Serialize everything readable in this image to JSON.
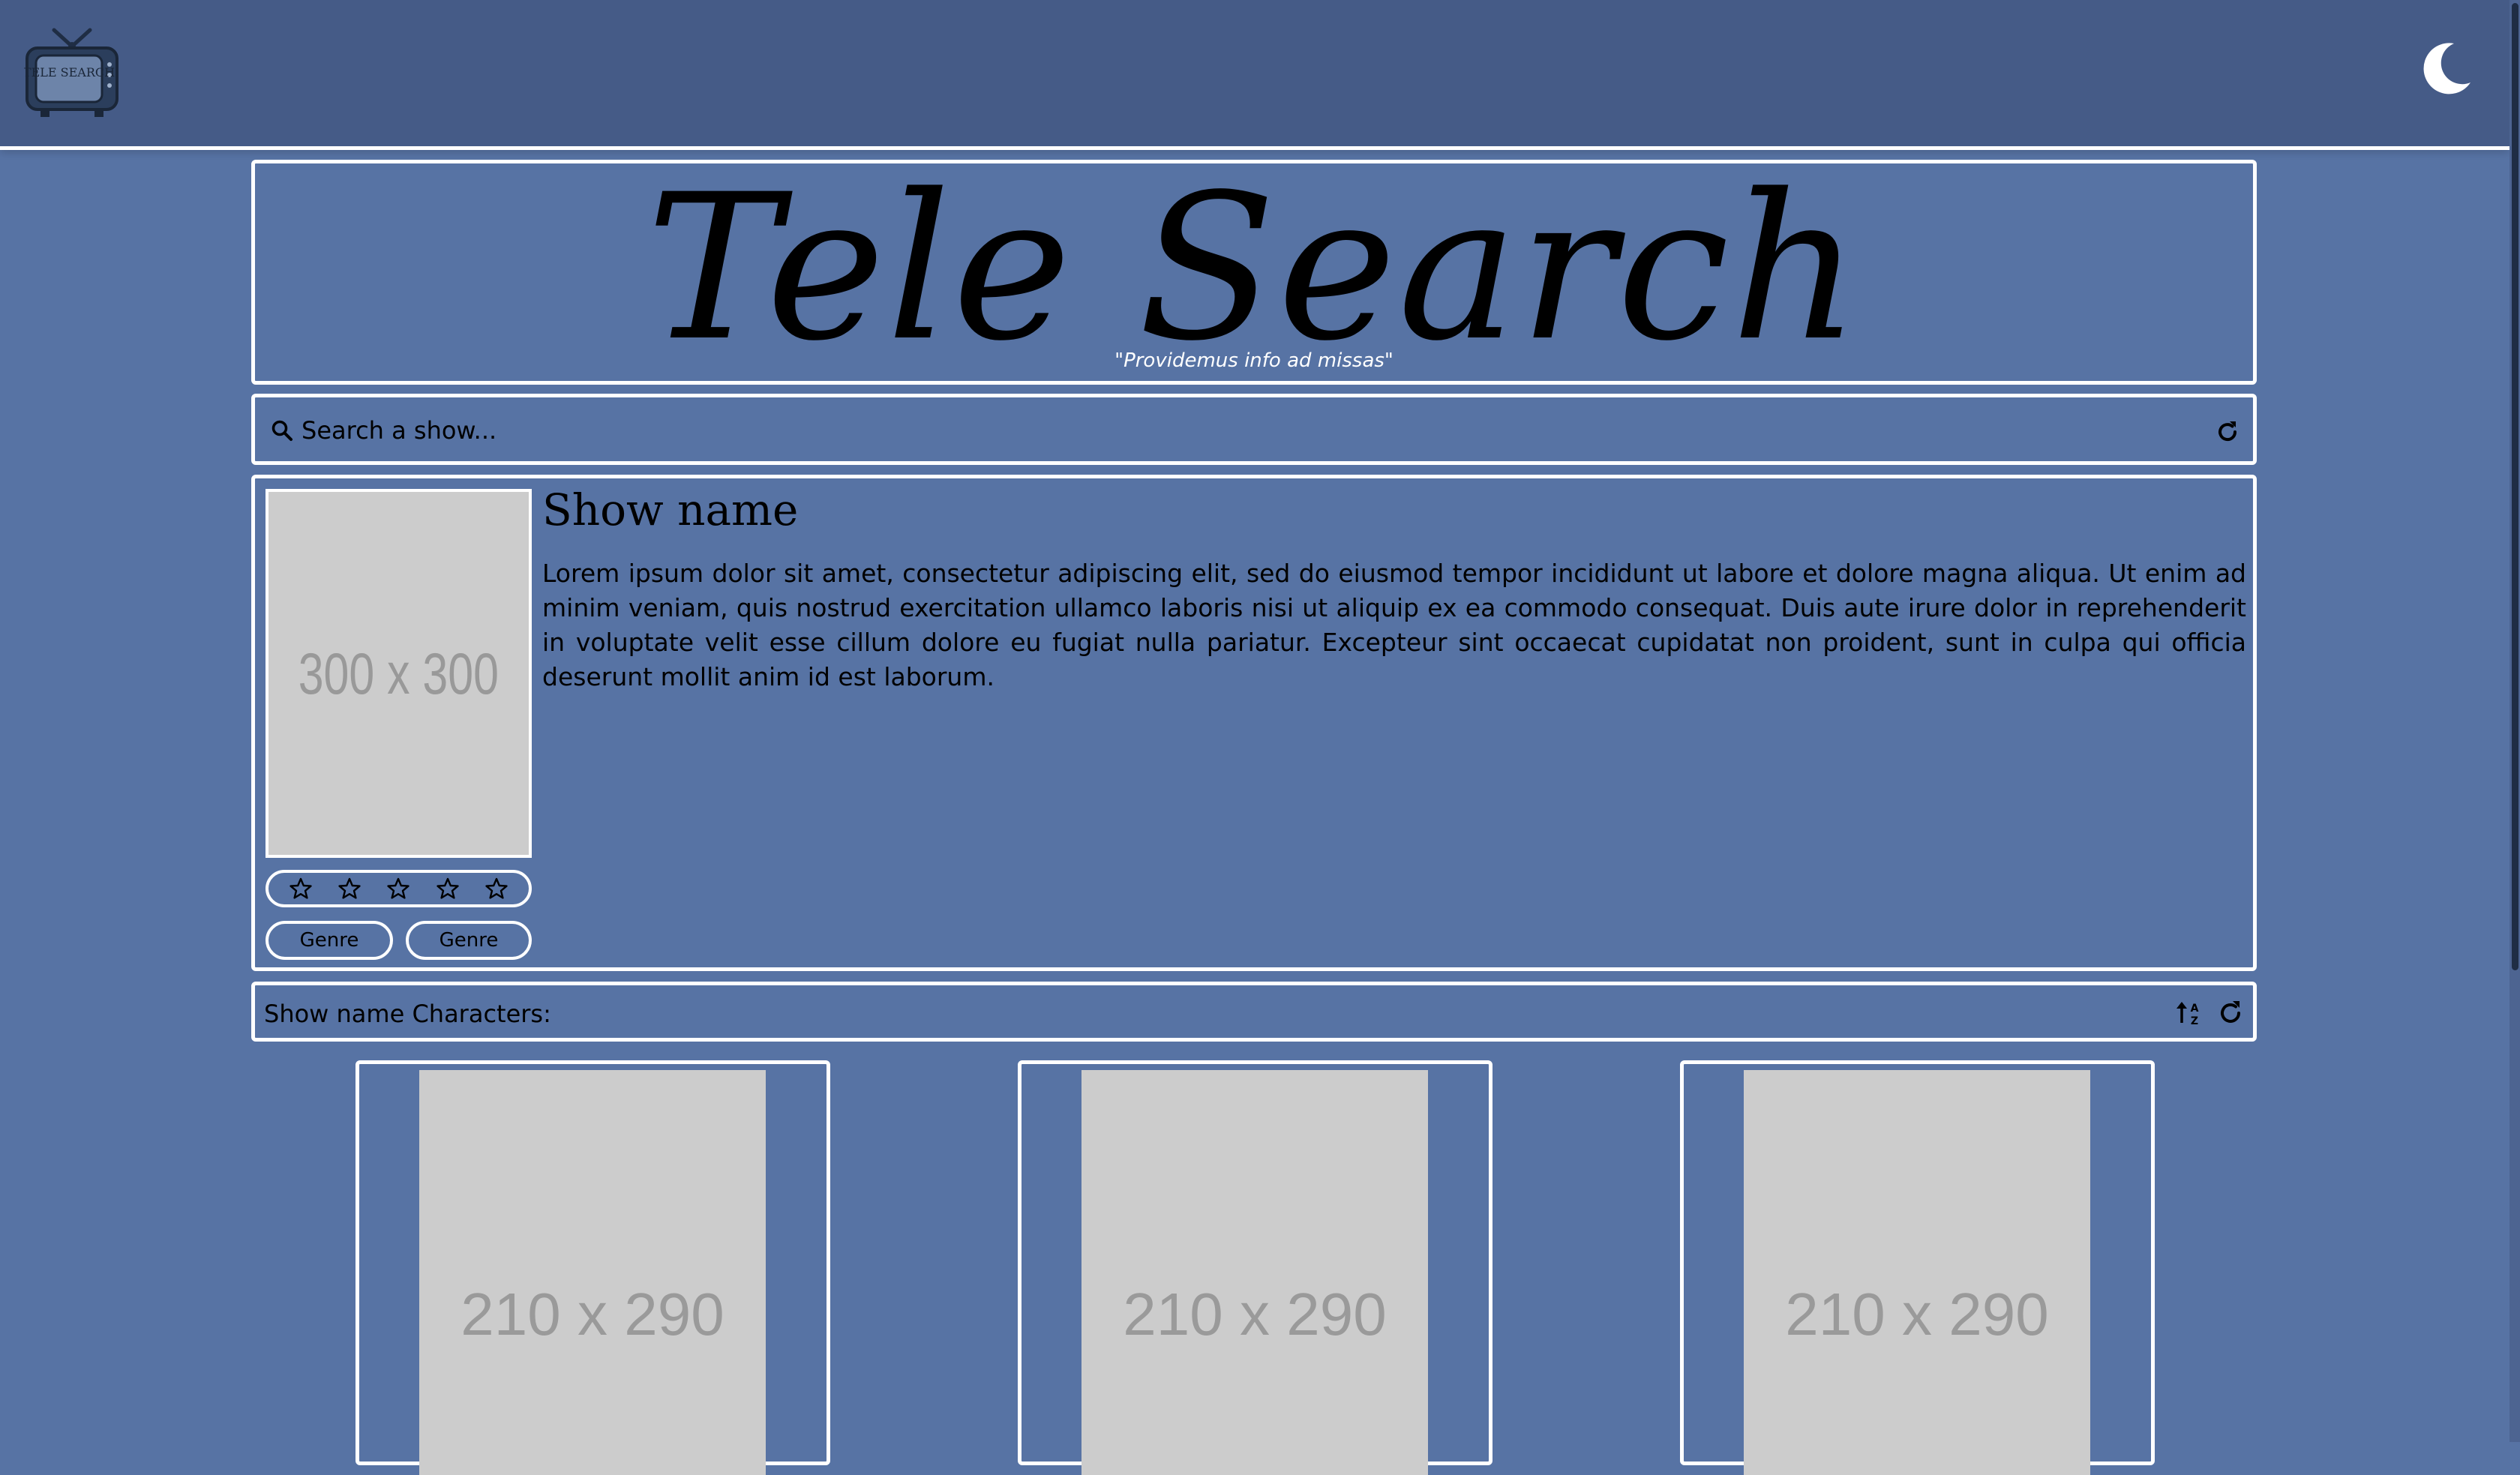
{
  "navbar": {
    "logo_text": "TELE SEARCH",
    "logo_icon": "tv-logo-icon",
    "theme_toggle_icon": "moon-icon"
  },
  "header": {
    "title": "Tele Search",
    "tagline": "\"Providemus info ad missas\""
  },
  "search": {
    "icon": "search-icon",
    "placeholder": "Search a show...",
    "value": "",
    "refresh_icon": "refresh-icon"
  },
  "show": {
    "poster_label": "300 x 300",
    "name": "Show name",
    "description": "Lorem ipsum dolor sit amet, consectetur adipiscing elit, sed do eiusmod tempor incididunt ut labore et dolore magna aliqua. Ut enim ad minim veniam, quis nostrud exercitation ullamco laboris nisi ut aliquip ex ea commodo consequat. Duis aute irure dolor in reprehenderit in voluptate velit esse cillum dolore eu fugiat nulla pariatur. Excepteur sint occaecat cupidatat non proident, sunt in culpa qui officia deserunt mollit anim id est laborum.",
    "rating": {
      "filled": 0,
      "max": 5,
      "icon": "star-outline-icon"
    },
    "genres": [
      "Genre",
      "Genre"
    ]
  },
  "characters": {
    "title": "Show name Characters:",
    "sort_icon": "sort-alpha-icon",
    "refresh_icon": "refresh-icon",
    "cards": [
      {
        "image_label": "210 x 290"
      },
      {
        "image_label": "210 x 290"
      },
      {
        "image_label": "210 x 290"
      }
    ]
  },
  "colors": {
    "background": "#5773a4",
    "navbar": "#455b87",
    "border": "#ffffff",
    "placeholder_image": "#cccccc"
  }
}
